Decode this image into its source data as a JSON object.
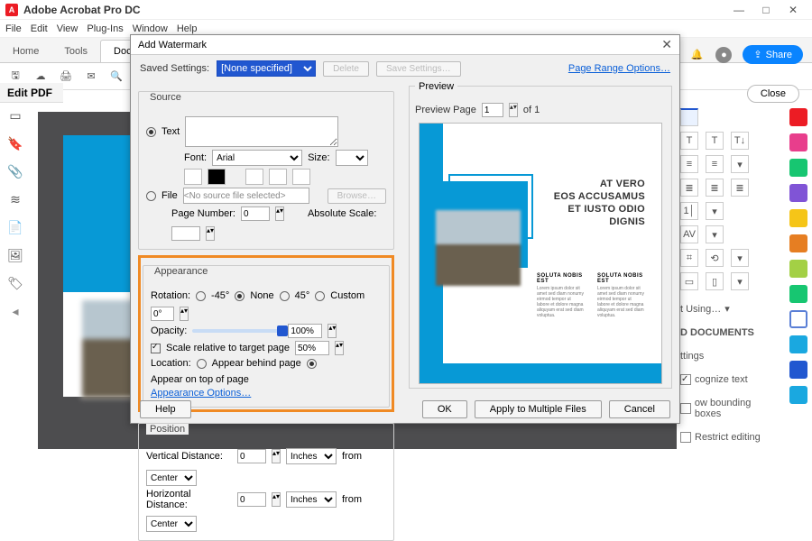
{
  "app_title": "Adobe Acrobat Pro DC",
  "menu": [
    "File",
    "Edit",
    "View",
    "Plug-Ins",
    "Window",
    "Help"
  ],
  "tabs": {
    "home": "Home",
    "tools": "Tools",
    "doc": "Docu…"
  },
  "context_bar": "Edit PDF",
  "top_right": {
    "share": "Share",
    "close": "Close"
  },
  "dialog": {
    "title": "Add Watermark",
    "saved_settings_label": "Saved Settings:",
    "saved_settings_value": "[None specified]",
    "delete": "Delete",
    "save_settings": "Save Settings…",
    "page_range": "Page Range Options…",
    "source": {
      "legend": "Source",
      "text_radio": "Text",
      "font_label": "Font:",
      "font_value": "Arial",
      "size_label": "Size:",
      "file_radio": "File",
      "file_field": "<No source file selected>",
      "browse": "Browse…",
      "page_number_label": "Page Number:",
      "page_number_value": "0",
      "abs_scale_label": "Absolute Scale:"
    },
    "appearance": {
      "legend": "Appearance",
      "rotation_label": "Rotation:",
      "rot_neg45": "-45°",
      "rot_none": "None",
      "rot_45": "45°",
      "rot_custom": "Custom",
      "rot_value": "0°",
      "opacity_label": "Opacity:",
      "opacity_value": "100%",
      "scale_relative": "Scale relative to target page",
      "scale_value": "50%",
      "location_label": "Location:",
      "loc_behind": "Appear behind page",
      "loc_top": "Appear on top of page",
      "options": "Appearance Options…"
    },
    "position": {
      "legend": "Position",
      "vdist_label": "Vertical Distance:",
      "vdist_value": "0",
      "hdist_label": "Horizontal Distance:",
      "hdist_value": "0",
      "unit": "Inches",
      "from": "from",
      "origin": "Center"
    },
    "footer": {
      "help": "Help",
      "ok": "OK",
      "apply_multiple": "Apply to Multiple Files",
      "cancel": "Cancel"
    },
    "preview": {
      "legend": "Preview",
      "page_label": "Preview Page",
      "page_value": "1",
      "of": "of 1",
      "hero1": "AT VERO",
      "hero2": "EOS ACCUSAMUS",
      "hero3": "ET IUSTO ODIO",
      "hero4": "DIGNIS",
      "col_head": "SOLUTA NOBIS EST",
      "col_body": "Lorem ipsum dolor sit amet sed diam nonumy eirmod tempor ut labore et dolore magna aliquyam erat sed diam voluptua."
    }
  },
  "right_panel": {
    "format_using": "t Using…",
    "docs": "D DOCUMENTS",
    "settings": "ttings",
    "recognize": "cognize text",
    "bounding": "ow bounding boxes",
    "restrict": "Restrict editing"
  }
}
